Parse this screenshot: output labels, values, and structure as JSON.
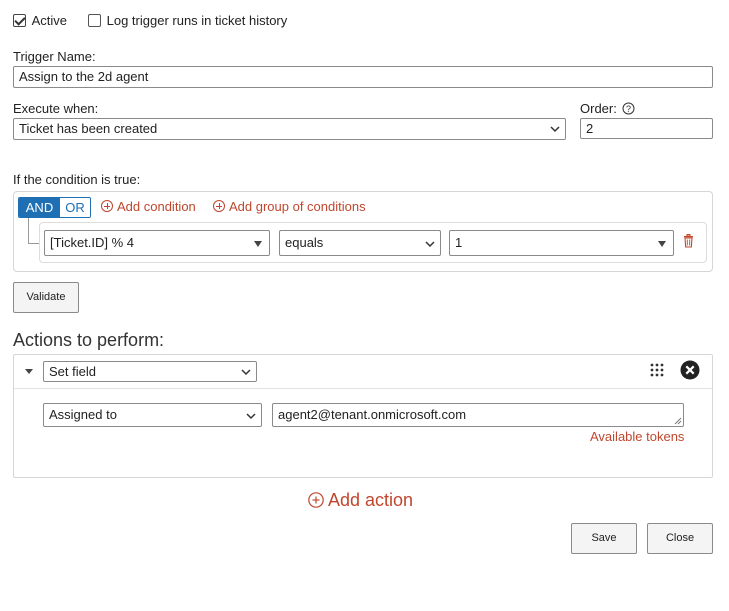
{
  "header": {
    "active_label": "Active",
    "active_checked": true,
    "log_label": "Log trigger runs in ticket history",
    "log_checked": false
  },
  "trigger_name": {
    "label": "Trigger Name:",
    "value": "Assign to the 2d agent"
  },
  "execute_when": {
    "label": "Execute when:",
    "value": "Ticket has been created"
  },
  "order": {
    "label": "Order:",
    "value": "2"
  },
  "conditions": {
    "label": "If the condition is true:",
    "and_label": "AND",
    "or_label": "OR",
    "add_condition": "Add condition",
    "add_group": "Add group of conditions",
    "row": {
      "field": "[Ticket.ID] % 4",
      "operator": "equals",
      "value": "1"
    },
    "validate_label": "Validate"
  },
  "actions": {
    "label": "Actions to perform:",
    "action_type": "Set field",
    "field": "Assigned to",
    "value": "agent2@tenant.onmicrosoft.com",
    "available_tokens": "Available tokens",
    "add_action": "Add action"
  },
  "footer": {
    "save_label": "Save",
    "close_label": "Close"
  },
  "colors": {
    "accent_blue": "#1f6fb5",
    "link_red": "#c0472e"
  }
}
